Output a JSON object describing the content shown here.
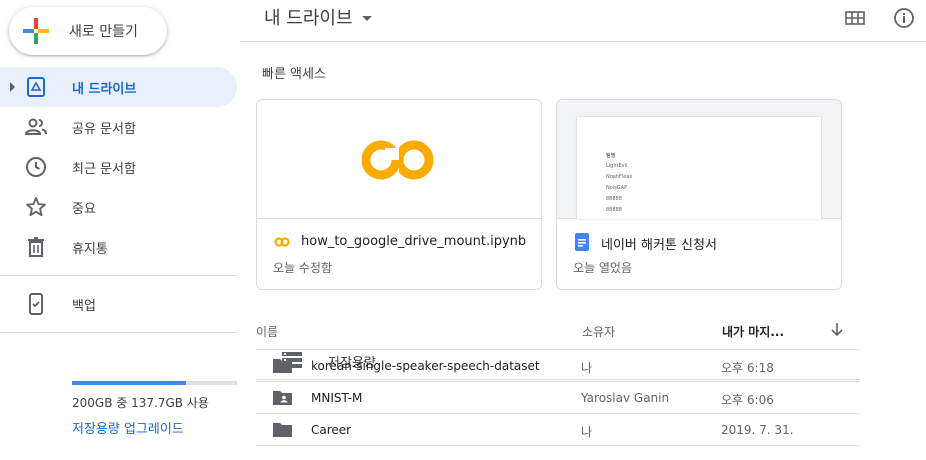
{
  "sidebar": {
    "new_button": "새로 만들기",
    "items": [
      {
        "label": "내 드라이브"
      },
      {
        "label": "공유 문서함"
      },
      {
        "label": "최근 문서함"
      },
      {
        "label": "중요"
      },
      {
        "label": "휴지통"
      }
    ],
    "backup": "백업",
    "storage": {
      "label": "저장용량",
      "used_fraction": 0.69,
      "usage_text": "200GB 중 137.7GB 사용",
      "upgrade": "저장용량 업그레이드"
    }
  },
  "header": {
    "title": "내 드라이브"
  },
  "quick_access": {
    "label": "빠른 액세스",
    "cards": [
      {
        "name": "how_to_google_drive_mount.ipynb",
        "subtitle": "오늘 수정함"
      },
      {
        "name": "네이버 해커톤 신청서",
        "subtitle": "오늘 열었음",
        "preview_lines": [
          "팀명",
          "LightEvil",
          "NoahFleas",
          "NoisGAP",
          "88888",
          "88888"
        ]
      }
    ]
  },
  "file_list": {
    "columns": {
      "name": "이름",
      "owner": "소유자",
      "modified": "내가 마지..."
    },
    "rows": [
      {
        "name": "korean-single-speaker-speech-dataset",
        "owner": "나",
        "modified": "오후 6:18"
      },
      {
        "name": "MNIST-M",
        "owner": "Yaroslav Ganin",
        "modified": "오후 6:06"
      },
      {
        "name": "Career",
        "owner": "나",
        "modified": "2019. 7. 31."
      }
    ]
  },
  "colors": {
    "accent": "#1967d2",
    "active_bg": "#e8f0fe",
    "storage_bar": "#4285f4",
    "colab_orange": "#f9ab00",
    "doc_blue": "#4285f4"
  }
}
